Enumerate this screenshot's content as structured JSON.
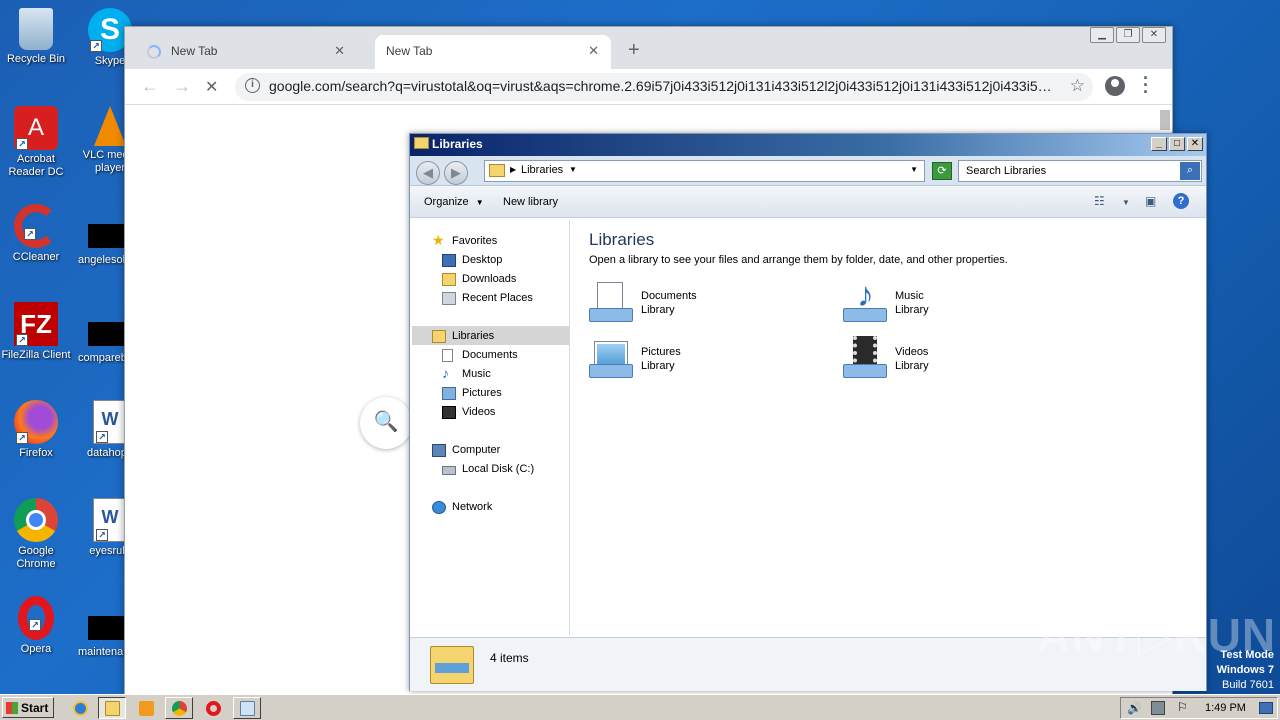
{
  "desktop": {
    "icons": [
      {
        "label": "Recycle Bin"
      },
      {
        "label": "Skype"
      },
      {
        "label": "Acrobat Reader DC"
      },
      {
        "label": "VLC media player"
      },
      {
        "label": "CCleaner"
      },
      {
        "label": "angelesob"
      },
      {
        "label": "FileZilla Client"
      },
      {
        "label": "compareb"
      },
      {
        "label": "Firefox"
      },
      {
        "label": "datahope"
      },
      {
        "label": "Google Chrome"
      },
      {
        "label": "eyesrule"
      },
      {
        "label": "Opera"
      },
      {
        "label": "maintena"
      }
    ]
  },
  "chrome": {
    "tabs": [
      {
        "label": "New Tab",
        "close": "✕"
      },
      {
        "label": "New Tab",
        "close": "✕"
      }
    ],
    "new_tab": "+",
    "url": "google.com/search?q=virustotal&oq=virust&aqs=chrome.2.69i57j0i433i512j0i131i433i512l2j0i433i512j0i131i433i512j0i433i5…",
    "back": "←",
    "forward": "→",
    "stop": "✕",
    "star": "☆",
    "search_glyph": "🔍"
  },
  "explorer": {
    "title": "Libraries",
    "address": "Libraries",
    "search_placeholder": "Search Libraries",
    "commands": {
      "organize": "Organize",
      "new_library": "New library"
    },
    "nav": {
      "favorites": "Favorites",
      "desktop": "Desktop",
      "downloads": "Downloads",
      "recent": "Recent Places",
      "libraries": "Libraries",
      "documents": "Documents",
      "music": "Music",
      "pictures": "Pictures",
      "videos": "Videos",
      "computer": "Computer",
      "local_disk": "Local Disk (C:)",
      "network": "Network"
    },
    "heading": "Libraries",
    "subheading": "Open a library to see your files and arrange them by folder, date, and other properties.",
    "libraries": [
      {
        "name": "Documents",
        "type": "Library"
      },
      {
        "name": "Music",
        "type": "Library"
      },
      {
        "name": "Pictures",
        "type": "Library"
      },
      {
        "name": "Videos",
        "type": "Library"
      }
    ],
    "status": "4 items"
  },
  "taskbar": {
    "start": "Start",
    "clock": "1:49 PM"
  },
  "watermark": "ANY▷RUN",
  "test_mode": {
    "line1": "Test Mode",
    "line2": "Windows 7",
    "line3": "Build 7601"
  }
}
